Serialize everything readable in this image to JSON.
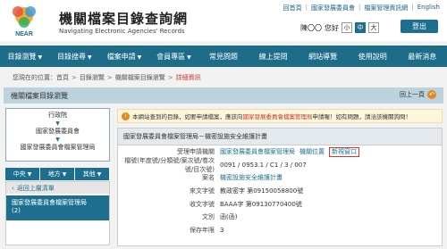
{
  "header": {
    "title": "機關檔案目錄查詢網",
    "subtitle": "Navigating Electronic Agencies' Records",
    "logo_text": "NEAR",
    "toplinks": [
      "回首頁",
      "國家發展委員會",
      "檔案管理資訊網",
      "English"
    ],
    "user_name": "陳〇〇",
    "user_greeting": "您好",
    "font_sizes": [
      "小",
      "中",
      "大"
    ],
    "active_font": "中",
    "logout": "登出"
  },
  "nav": [
    {
      "label": "目錄瀏覽",
      "caret": true
    },
    {
      "label": "目錄搜尋",
      "caret": true
    },
    {
      "label": "檔案申請",
      "caret": true
    },
    {
      "label": "會員專區",
      "caret": true
    },
    {
      "label": "常見問題",
      "caret": false
    },
    {
      "label": "線上提問",
      "caret": false
    },
    {
      "label": "網站導覽",
      "caret": false
    },
    {
      "label": "使用說明",
      "caret": false
    },
    {
      "label": "最新消息",
      "caret": false
    }
  ],
  "breadcrumb": {
    "prefix": "您現在的位置：",
    "items": [
      "首頁",
      "目錄瀏覽",
      "機關檔案目錄瀏覽"
    ],
    "current": "詳細資訊"
  },
  "section": {
    "title": "機關檔案目錄瀏覽",
    "back": "回上一頁"
  },
  "tree": [
    "行政院",
    "國家發展委員會",
    "國家發展委員會檔案管理局"
  ],
  "tabs": [
    "中央",
    "地方",
    "其他"
  ],
  "sidebar": {
    "back_list": "返回上層清單",
    "unit_name": "國家發展委員會檔案管理局",
    "unit_count": "(2)"
  },
  "notice": {
    "text_before": "本網站查到的目錄，如要申請檔案，應該向",
    "highlight": "國家發展委員會檔案管理局",
    "text_after": "申請喔！如有問題，請洽該機關詢問！"
  },
  "record": {
    "heading": "國家發展委員會檔案管理局－機密設施安全維護計畫",
    "rows": [
      {
        "label": "受理申請機關",
        "value": "國家發展委員會檔案管理局",
        "value_class": "link",
        "extra": "機關位置",
        "extra2": "新視窗口"
      },
      {
        "label": "檔號(年度號/分類號/案次號/卷次號/目次號)",
        "value": "0091 / 0953.1 / C1 / 3 / 007",
        "value_class": ""
      },
      {
        "label": "案名",
        "value": "機密設施安全維護計畫",
        "value_class": "link"
      },
      {
        "label": "來文字號",
        "value": "教政密字 第09150058800號",
        "value_class": ""
      },
      {
        "label": "收文字號",
        "value": "BAAA字 第09130770400號",
        "value_class": ""
      },
      {
        "label": "文別",
        "value": "函(函)",
        "value_class": ""
      },
      {
        "label": "保存年限",
        "value": "3",
        "value_class": ""
      }
    ]
  },
  "colors": {
    "accent": "#1e6f8f",
    "nav": "#1d6d8a",
    "highlight_red": "#c0392b"
  }
}
